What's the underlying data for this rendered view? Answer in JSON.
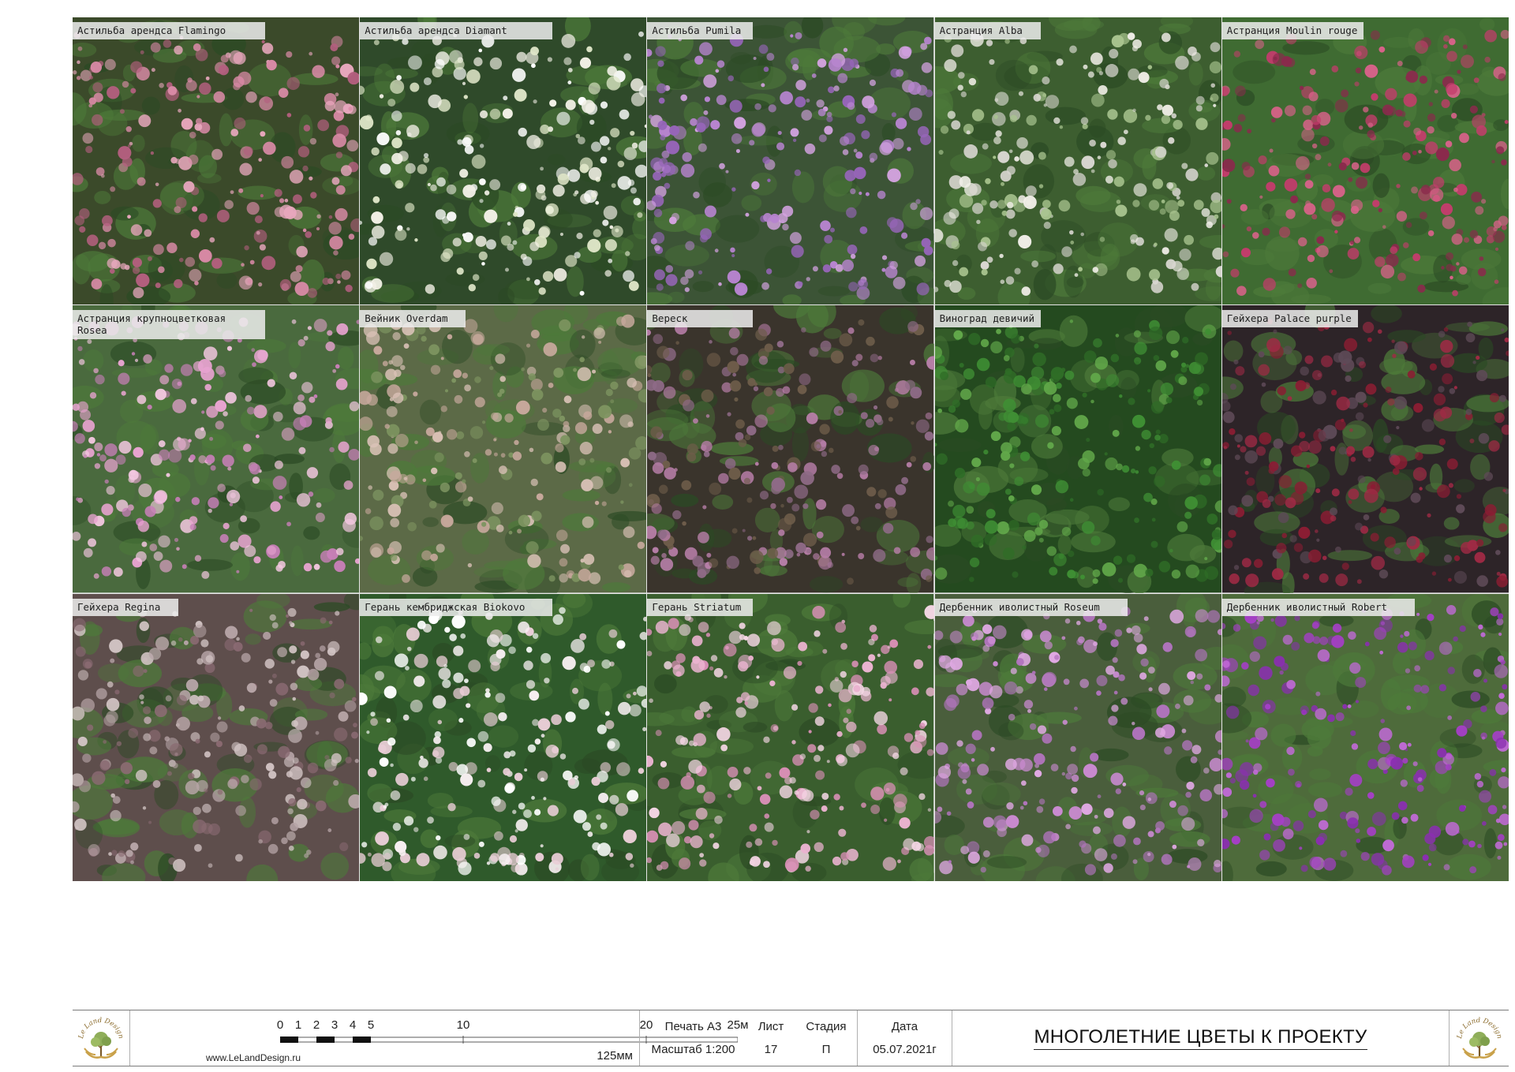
{
  "plants": [
    {
      "label": "Астильба арендса Flamingo",
      "palette": {
        "bg": "#3b4a2a",
        "c1": "#d98aa6",
        "c2": "#e8a7bd",
        "c3": "#b35f7e"
      }
    },
    {
      "label": "Астильба арендса Diamant",
      "palette": {
        "bg": "#2f4a2a",
        "c1": "#f2f0e6",
        "c2": "#dfe6c8",
        "c3": "#ffffff"
      }
    },
    {
      "label": "Астильба Pumila",
      "palette": {
        "bg": "#3c5436",
        "c1": "#b784cf",
        "c2": "#d3a2e0",
        "c3": "#9665b8"
      }
    },
    {
      "label": "Астранция Alba",
      "palette": {
        "bg": "#3d5e30",
        "c1": "#f1eee8",
        "c2": "#d8d6d0",
        "c3": "#a9c48f"
      }
    },
    {
      "label": "Астранция Moulin rouge",
      "palette": {
        "bg": "#3f6b32",
        "c1": "#c23d6b",
        "c2": "#d9628a",
        "c3": "#8a2a4c"
      }
    },
    {
      "label": "Астранция крупноцветковая Rosea",
      "palette": {
        "bg": "#4a6a3e",
        "c1": "#e7a3cf",
        "c2": "#c77fb7",
        "c3": "#f3c7e0"
      }
    },
    {
      "label": "Вейник Overdam",
      "palette": {
        "bg": "#5c6a47",
        "c1": "#d9c1b6",
        "c2": "#c8a99d",
        "c3": "#7e9561"
      }
    },
    {
      "label": "Вереск",
      "palette": {
        "bg": "#3a342c",
        "c1": "#b77ea8",
        "c2": "#8e6a86",
        "c3": "#6e5d4a"
      }
    },
    {
      "label": "Виноград девичий",
      "palette": {
        "bg": "#244a1f",
        "c1": "#3f8f34",
        "c2": "#62a84a",
        "c3": "#2f6d27"
      }
    },
    {
      "label": "Гейхера Palace purple",
      "palette": {
        "bg": "#2d2428",
        "c1": "#8a1d33",
        "c2": "#5e4a57",
        "c3": "#a02a45"
      }
    },
    {
      "label": "Гейхера Regina",
      "palette": {
        "bg": "#5e4e4c",
        "c1": "#b6a4a6",
        "c2": "#d2c4c4",
        "c3": "#8a6a72"
      }
    },
    {
      "label": "Герань кембриджская Biokovo",
      "palette": {
        "bg": "#2f5a2b",
        "c1": "#f6eef0",
        "c2": "#e9cdd6",
        "c3": "#ffffff"
      }
    },
    {
      "label": "Герань Striatum",
      "palette": {
        "bg": "#3a5e2e",
        "c1": "#eab3cf",
        "c2": "#f4d6e4",
        "c3": "#d88fb5"
      }
    },
    {
      "label": "Дербенник иволистный Roseum",
      "palette": {
        "bg": "#4a5e3c",
        "c1": "#c98ad0",
        "c2": "#b274be",
        "c3": "#dfa8e2"
      }
    },
    {
      "label": "Дербенник иволистный Robert",
      "palette": {
        "bg": "#4e6b3b",
        "c1": "#a53fc6",
        "c2": "#8a2fb0",
        "c3": "#c26ad8"
      }
    }
  ],
  "titleblock": {
    "website": "www.LeLandDesign.ru",
    "scale_ticks": [
      "0",
      "1",
      "2",
      "3",
      "4",
      "5",
      "10",
      "20",
      "25м"
    ],
    "scale_unit_mm": "125мм",
    "print_label": "Печать А3",
    "scale_label": "Масштаб 1:200",
    "sheet_header": "Лист",
    "sheet_value": "17",
    "stage_header": "Стадия",
    "stage_value": "П",
    "date_header": "Дата",
    "date_value": "05.07.2021г",
    "title": "МНОГОЛЕТНИЕ ЦВЕТЫ К ПРОЕКТУ",
    "logo_text": "Le Land Design"
  }
}
